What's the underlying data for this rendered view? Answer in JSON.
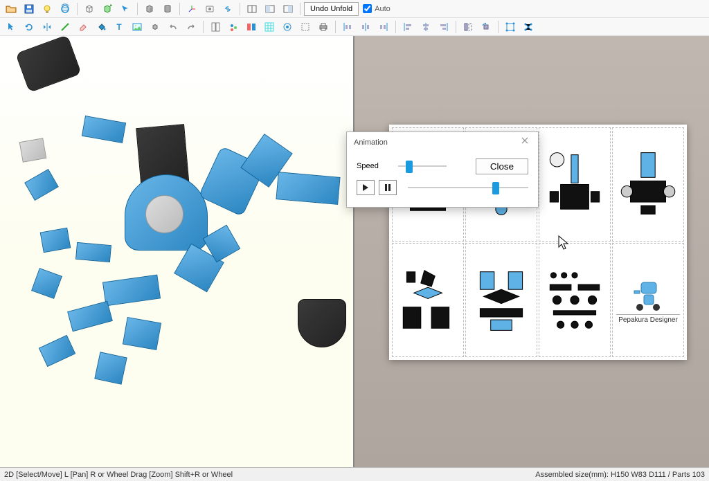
{
  "toolbar": {
    "undo_unfold_label": "Undo Unfold",
    "auto_label": "Auto",
    "auto_checked": true,
    "row1_icons": [
      "folder-open-icon",
      "save-icon",
      "lightbulb-icon",
      "world-rotate-icon",
      "cube-wire-icon",
      "cube-arrow-icon",
      "arrow-pick-icon",
      "cube-solid-icon",
      "cylinder-icon",
      "axes-icon",
      "object-icon",
      "link-icon",
      "panel-split-icon",
      "panel-single-icon",
      "panel-single2-icon"
    ],
    "row2_icons": [
      "cursor-icon",
      "rotate-icon",
      "flip-h-icon",
      "edit-line-icon",
      "eraser-icon",
      "paint-bucket-icon",
      "text-t-icon",
      "image-icon",
      "cube-mini-icon",
      "undo-icon",
      "redo-icon",
      "page-layout-icon",
      "effects-icon",
      "align-panel-icon",
      "grid-cyan-icon",
      "target-icon",
      "dotted-box-icon",
      "print-icon",
      "dist-h-left-icon",
      "dist-h-center-icon",
      "dist-h-right-icon",
      "align-left-icon",
      "align-center-icon",
      "align-right-icon",
      "flip-object-icon",
      "rotate-left-icon",
      "bounds-icon",
      "network-icon"
    ]
  },
  "dialog": {
    "title": "Animation",
    "speed_label": "Speed",
    "close_label": "Close",
    "speed_pos_pct": 15,
    "progress_pos_pct": 70
  },
  "papercraft": {
    "logo_label": "Pepakura Designer"
  },
  "status": {
    "left": "2D [Select/Move] L [Pan] R or Wheel Drag [Zoom] Shift+R or Wheel",
    "right": "Assembled size(mm): H150 W83 D111 / Parts 103"
  },
  "colors": {
    "accent": "#1a9be0",
    "robot_blue": "#4fa8dc",
    "robot_dark": "#2a2a2a"
  }
}
